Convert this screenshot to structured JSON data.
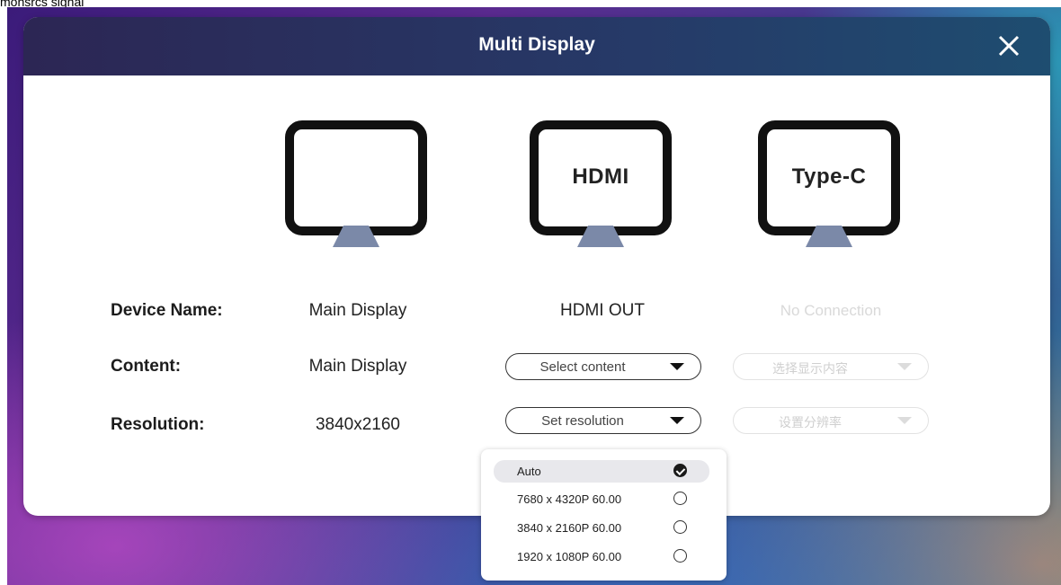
{
  "header": {
    "caption": "monsrcs signal",
    "title": "Multi Display",
    "close_icon": "close-icon"
  },
  "colors": {
    "titlebar": "#263a68",
    "monitor_frame": "#111111",
    "monitor_stand": "#7b89a8",
    "disabled_text": "#d9d9d9"
  },
  "monitors": [
    {
      "label": ""
    },
    {
      "label": "HDMI"
    },
    {
      "label": "Type-C"
    }
  ],
  "rows": {
    "device_name": {
      "label": "Device Name:",
      "main": "Main Display",
      "hdmi": "HDMI OUT",
      "typec": "No Connection"
    },
    "content": {
      "label": "Content:",
      "main": "Main Display",
      "hdmi_dropdown": "Select content",
      "typec_dropdown": "选择显示内容"
    },
    "resolution": {
      "label": "Resolution:",
      "main": "3840x2160",
      "hdmi_dropdown": "Set resolution",
      "typec_dropdown": "设置分辨率"
    }
  },
  "resolution_menu": {
    "options": [
      {
        "label": "Auto",
        "selected": true
      },
      {
        "label": "7680 x 4320P 60.00",
        "selected": false
      },
      {
        "label": "3840 x 2160P 60.00",
        "selected": false
      },
      {
        "label": "1920 x 1080P 60.00",
        "selected": false
      }
    ]
  }
}
